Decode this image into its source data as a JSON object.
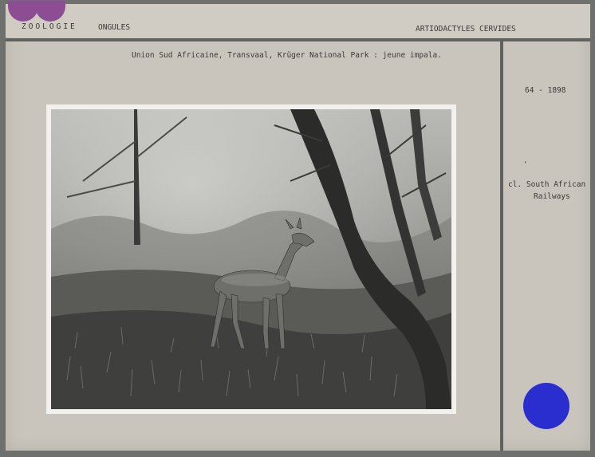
{
  "header": {
    "category": "ZOOLOGIE",
    "subcategory": "ONGULES",
    "taxonomy": "ARTIODACTYLES",
    "family": "CERVIDES"
  },
  "caption": "Union Sud Africaine, Transvaal, Krüger National Park : jeune impala.",
  "side_panel": {
    "reference": "64 - 1898",
    "mark": "'",
    "credit_line1": "cl. South African",
    "credit_line2": "Railways"
  },
  "colors": {
    "card": "#c9c5bc",
    "rule": "#5f625e",
    "purple_dot": "#8d4d93",
    "blue_dot": "#2b2ecf"
  },
  "photo": {
    "content": "black-and-white photograph"
  }
}
